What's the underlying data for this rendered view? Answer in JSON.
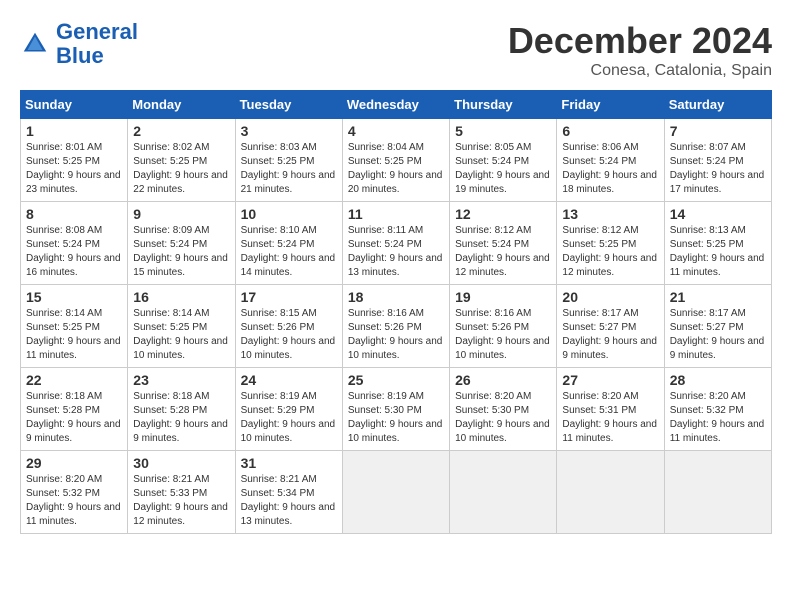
{
  "logo": {
    "line1": "General",
    "line2": "Blue"
  },
  "title": "December 2024",
  "location": "Conesa, Catalonia, Spain",
  "days_of_week": [
    "Sunday",
    "Monday",
    "Tuesday",
    "Wednesday",
    "Thursday",
    "Friday",
    "Saturday"
  ],
  "weeks": [
    [
      {
        "day": "1",
        "sunrise": "8:01 AM",
        "sunset": "5:25 PM",
        "daylight": "9 hours and 23 minutes."
      },
      {
        "day": "2",
        "sunrise": "8:02 AM",
        "sunset": "5:25 PM",
        "daylight": "9 hours and 22 minutes."
      },
      {
        "day": "3",
        "sunrise": "8:03 AM",
        "sunset": "5:25 PM",
        "daylight": "9 hours and 21 minutes."
      },
      {
        "day": "4",
        "sunrise": "8:04 AM",
        "sunset": "5:25 PM",
        "daylight": "9 hours and 20 minutes."
      },
      {
        "day": "5",
        "sunrise": "8:05 AM",
        "sunset": "5:24 PM",
        "daylight": "9 hours and 19 minutes."
      },
      {
        "day": "6",
        "sunrise": "8:06 AM",
        "sunset": "5:24 PM",
        "daylight": "9 hours and 18 minutes."
      },
      {
        "day": "7",
        "sunrise": "8:07 AM",
        "sunset": "5:24 PM",
        "daylight": "9 hours and 17 minutes."
      }
    ],
    [
      {
        "day": "8",
        "sunrise": "8:08 AM",
        "sunset": "5:24 PM",
        "daylight": "9 hours and 16 minutes."
      },
      {
        "day": "9",
        "sunrise": "8:09 AM",
        "sunset": "5:24 PM",
        "daylight": "9 hours and 15 minutes."
      },
      {
        "day": "10",
        "sunrise": "8:10 AM",
        "sunset": "5:24 PM",
        "daylight": "9 hours and 14 minutes."
      },
      {
        "day": "11",
        "sunrise": "8:11 AM",
        "sunset": "5:24 PM",
        "daylight": "9 hours and 13 minutes."
      },
      {
        "day": "12",
        "sunrise": "8:12 AM",
        "sunset": "5:24 PM",
        "daylight": "9 hours and 12 minutes."
      },
      {
        "day": "13",
        "sunrise": "8:12 AM",
        "sunset": "5:25 PM",
        "daylight": "9 hours and 12 minutes."
      },
      {
        "day": "14",
        "sunrise": "8:13 AM",
        "sunset": "5:25 PM",
        "daylight": "9 hours and 11 minutes."
      }
    ],
    [
      {
        "day": "15",
        "sunrise": "8:14 AM",
        "sunset": "5:25 PM",
        "daylight": "9 hours and 11 minutes."
      },
      {
        "day": "16",
        "sunrise": "8:14 AM",
        "sunset": "5:25 PM",
        "daylight": "9 hours and 10 minutes."
      },
      {
        "day": "17",
        "sunrise": "8:15 AM",
        "sunset": "5:26 PM",
        "daylight": "9 hours and 10 minutes."
      },
      {
        "day": "18",
        "sunrise": "8:16 AM",
        "sunset": "5:26 PM",
        "daylight": "9 hours and 10 minutes."
      },
      {
        "day": "19",
        "sunrise": "8:16 AM",
        "sunset": "5:26 PM",
        "daylight": "9 hours and 10 minutes."
      },
      {
        "day": "20",
        "sunrise": "8:17 AM",
        "sunset": "5:27 PM",
        "daylight": "9 hours and 9 minutes."
      },
      {
        "day": "21",
        "sunrise": "8:17 AM",
        "sunset": "5:27 PM",
        "daylight": "9 hours and 9 minutes."
      }
    ],
    [
      {
        "day": "22",
        "sunrise": "8:18 AM",
        "sunset": "5:28 PM",
        "daylight": "9 hours and 9 minutes."
      },
      {
        "day": "23",
        "sunrise": "8:18 AM",
        "sunset": "5:28 PM",
        "daylight": "9 hours and 9 minutes."
      },
      {
        "day": "24",
        "sunrise": "8:19 AM",
        "sunset": "5:29 PM",
        "daylight": "9 hours and 10 minutes."
      },
      {
        "day": "25",
        "sunrise": "8:19 AM",
        "sunset": "5:30 PM",
        "daylight": "9 hours and 10 minutes."
      },
      {
        "day": "26",
        "sunrise": "8:20 AM",
        "sunset": "5:30 PM",
        "daylight": "9 hours and 10 minutes."
      },
      {
        "day": "27",
        "sunrise": "8:20 AM",
        "sunset": "5:31 PM",
        "daylight": "9 hours and 11 minutes."
      },
      {
        "day": "28",
        "sunrise": "8:20 AM",
        "sunset": "5:32 PM",
        "daylight": "9 hours and 11 minutes."
      }
    ],
    [
      {
        "day": "29",
        "sunrise": "8:20 AM",
        "sunset": "5:32 PM",
        "daylight": "9 hours and 11 minutes."
      },
      {
        "day": "30",
        "sunrise": "8:21 AM",
        "sunset": "5:33 PM",
        "daylight": "9 hours and 12 minutes."
      },
      {
        "day": "31",
        "sunrise": "8:21 AM",
        "sunset": "5:34 PM",
        "daylight": "9 hours and 13 minutes."
      },
      null,
      null,
      null,
      null
    ]
  ],
  "labels": {
    "sunrise": "Sunrise: ",
    "sunset": "Sunset: ",
    "daylight": "Daylight: "
  }
}
